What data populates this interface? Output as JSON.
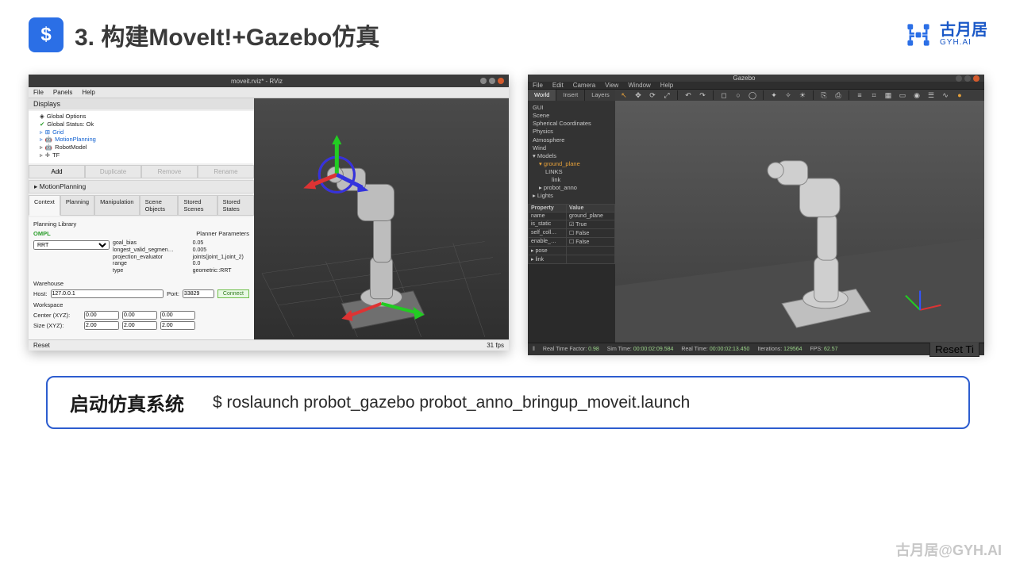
{
  "header": {
    "logo_glyph": "$",
    "title": "3. 构建MoveIt!+Gazebo仿真",
    "brand_cn": "古月居",
    "brand_en": "GYH.AI"
  },
  "rviz": {
    "window_title": "moveit.rviz* - RViz",
    "menus": [
      "File",
      "Panels",
      "Help"
    ],
    "displays_label": "Displays",
    "tree": {
      "global_options": "Global Options",
      "global_status": "Global Status: Ok",
      "grid": "Grid",
      "motion_planning": "MotionPlanning",
      "robot_model": "RobotModel",
      "tf": "TF"
    },
    "row_buttons": {
      "add": "Add",
      "duplicate": "Duplicate",
      "remove": "Remove",
      "rename": "Rename"
    },
    "mp_panel": "MotionPlanning",
    "tabs": [
      "Context",
      "Planning",
      "Manipulation",
      "Scene Objects",
      "Stored Scenes",
      "Stored States"
    ],
    "planning_library": "Planning Library",
    "ompl": "OMPL",
    "planner": "RRT",
    "params_header": "Planner Parameters",
    "params": [
      [
        "goal_bias",
        "0.05"
      ],
      [
        "longest_valid_segmen…",
        "0.005"
      ],
      [
        "projection_evaluator",
        "joints(joint_1,joint_2)"
      ],
      [
        "range",
        "0.0"
      ],
      [
        "type",
        "geometric::RRT"
      ]
    ],
    "warehouse": "Warehouse",
    "host_label": "Host:",
    "host": "127.0.0.1",
    "port_label": "Port:",
    "port": "33829",
    "connect": "Connect",
    "workspace": "Workspace",
    "center_label": "Center (XYZ):",
    "size_label": "Size (XYZ):",
    "center": [
      "0.00",
      "0.00",
      "0.00"
    ],
    "size": [
      "2.00",
      "2.00",
      "2.00"
    ],
    "reset": "Reset",
    "fps": "31 fps"
  },
  "gazebo": {
    "window_title": "Gazebo",
    "menus": [
      "File",
      "Edit",
      "Camera",
      "View",
      "Window",
      "Help"
    ],
    "left_tabs": [
      "World",
      "Insert",
      "Layers"
    ],
    "world_tree": {
      "gui": "GUI",
      "scene": "Scene",
      "spherical": "Spherical Coordinates",
      "physics": "Physics",
      "atmo": "Atmosphere",
      "wind": "Wind",
      "models": "Models",
      "ground": "ground_plane",
      "links": "LINKS",
      "link": "link",
      "probot": "probot_anno",
      "lights": "Lights"
    },
    "prop_header": [
      "Property",
      "Value"
    ],
    "prop_rows": [
      [
        "name",
        "ground_plane"
      ],
      [
        "is_static",
        "True"
      ],
      [
        "self_coll…",
        "False"
      ],
      [
        "enable_…",
        "False"
      ],
      [
        "pose",
        ""
      ],
      [
        "link",
        ""
      ]
    ],
    "status": {
      "pause_label": "‖",
      "rtf_label": "Real Time Factor:",
      "rtf": "0.98",
      "sim_label": "Sim Time:",
      "sim": "00:00:02:09.584",
      "real_label": "Real Time:",
      "real": "00:00:02:13.450",
      "iter_label": "Iterations:",
      "iter": "129564",
      "fps_label": "FPS:",
      "fps": "62.57",
      "reset": "Reset Ti"
    }
  },
  "cmd": {
    "label": "启动仿真系统",
    "text": "$ roslaunch probot_gazebo probot_anno_bringup_moveit.launch"
  },
  "watermark": "古月居@GYH.AI"
}
